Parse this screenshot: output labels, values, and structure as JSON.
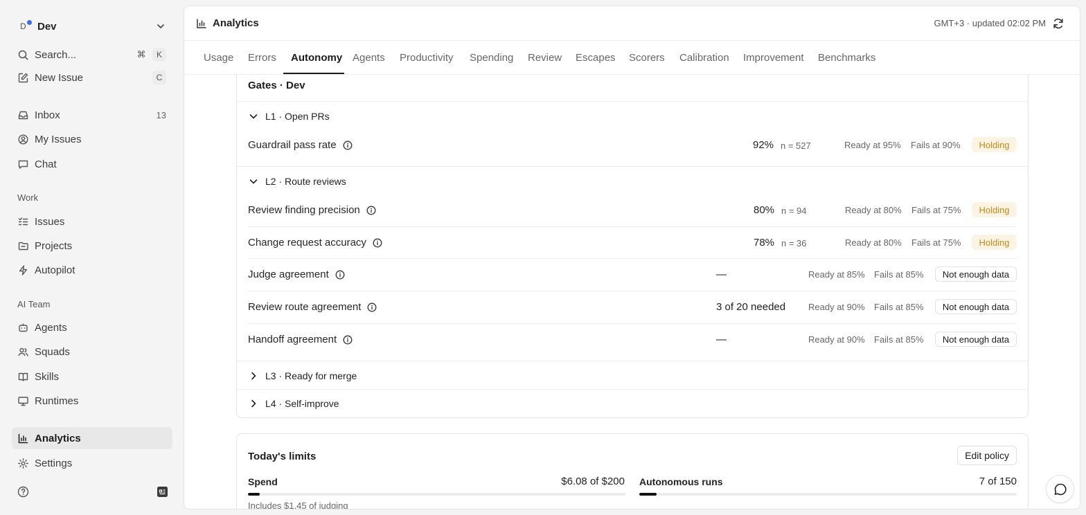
{
  "workspace": {
    "initial": "D",
    "name": "Dev"
  },
  "sidebar": {
    "search_label": "Search...",
    "search_kbd_1": "⌘",
    "search_kbd_2": "K",
    "new_issue_label": "New Issue",
    "new_issue_kbd": "C",
    "inbox_label": "Inbox",
    "inbox_count": "13",
    "my_issues_label": "My Issues",
    "chat_label": "Chat",
    "work_section": "Work",
    "issues_label": "Issues",
    "projects_label": "Projects",
    "autopilot_label": "Autopilot",
    "ai_section": "AI Team",
    "agents_label": "Agents",
    "squads_label": "Squads",
    "skills_label": "Skills",
    "runtimes_label": "Runtimes",
    "analytics_label": "Analytics",
    "settings_label": "Settings"
  },
  "header": {
    "title": "Analytics",
    "updated": "GMT+3 · updated 02:02 PM"
  },
  "tabs": [
    "Usage",
    "Errors",
    "Autonomy",
    "Agents",
    "Productivity",
    "Spending",
    "Review",
    "Escapes",
    "Scorers",
    "Calibration",
    "Improvement",
    "Benchmarks"
  ],
  "active_tab": "Autonomy",
  "gates": {
    "title": "Gates · Dev",
    "l1": {
      "label": "L1 · Open PRs",
      "metrics": [
        {
          "name": "Guardrail pass rate",
          "value": "92%",
          "n": "n = 527",
          "ready": "Ready at 95%",
          "fails": "Fails at 90%",
          "status": "Holding"
        }
      ]
    },
    "l2": {
      "label": "L2 · Route reviews",
      "metrics": [
        {
          "name": "Review finding precision",
          "value": "80%",
          "n": "n = 94",
          "ready": "Ready at 80%",
          "fails": "Fails at 75%",
          "status": "Holding"
        },
        {
          "name": "Change request accuracy",
          "value": "78%",
          "n": "n = 36",
          "ready": "Ready at 80%",
          "fails": "Fails at 75%",
          "status": "Holding"
        },
        {
          "name": "Judge agreement",
          "value": "—",
          "n": "",
          "ready": "Ready at 85%",
          "fails": "Fails at 85%",
          "status": "Not enough data"
        },
        {
          "name": "Review route agreement",
          "value": "3 of 20 needed",
          "n": "",
          "ready": "Ready at 90%",
          "fails": "Fails at 85%",
          "status": "Not enough data"
        },
        {
          "name": "Handoff agreement",
          "value": "—",
          "n": "",
          "ready": "Ready at 90%",
          "fails": "Fails at 85%",
          "status": "Not enough data"
        }
      ]
    },
    "l3_label": "L3 · Ready for merge",
    "l4_label": "L4 · Self-improve"
  },
  "limits": {
    "title": "Today's limits",
    "edit_label": "Edit policy",
    "spend_label": "Spend",
    "spend_value": "$6.08 of $200",
    "spend_fraction": 0.0304,
    "spend_note": "Includes $1.45 of judging",
    "runs_label": "Autonomous runs",
    "runs_value": "7 of 150",
    "runs_fraction": 0.0467
  },
  "colors": {
    "accent_dot": "#3a6df0",
    "holding_text": "#c78b14",
    "holding_bg": "#fbf3e3"
  }
}
